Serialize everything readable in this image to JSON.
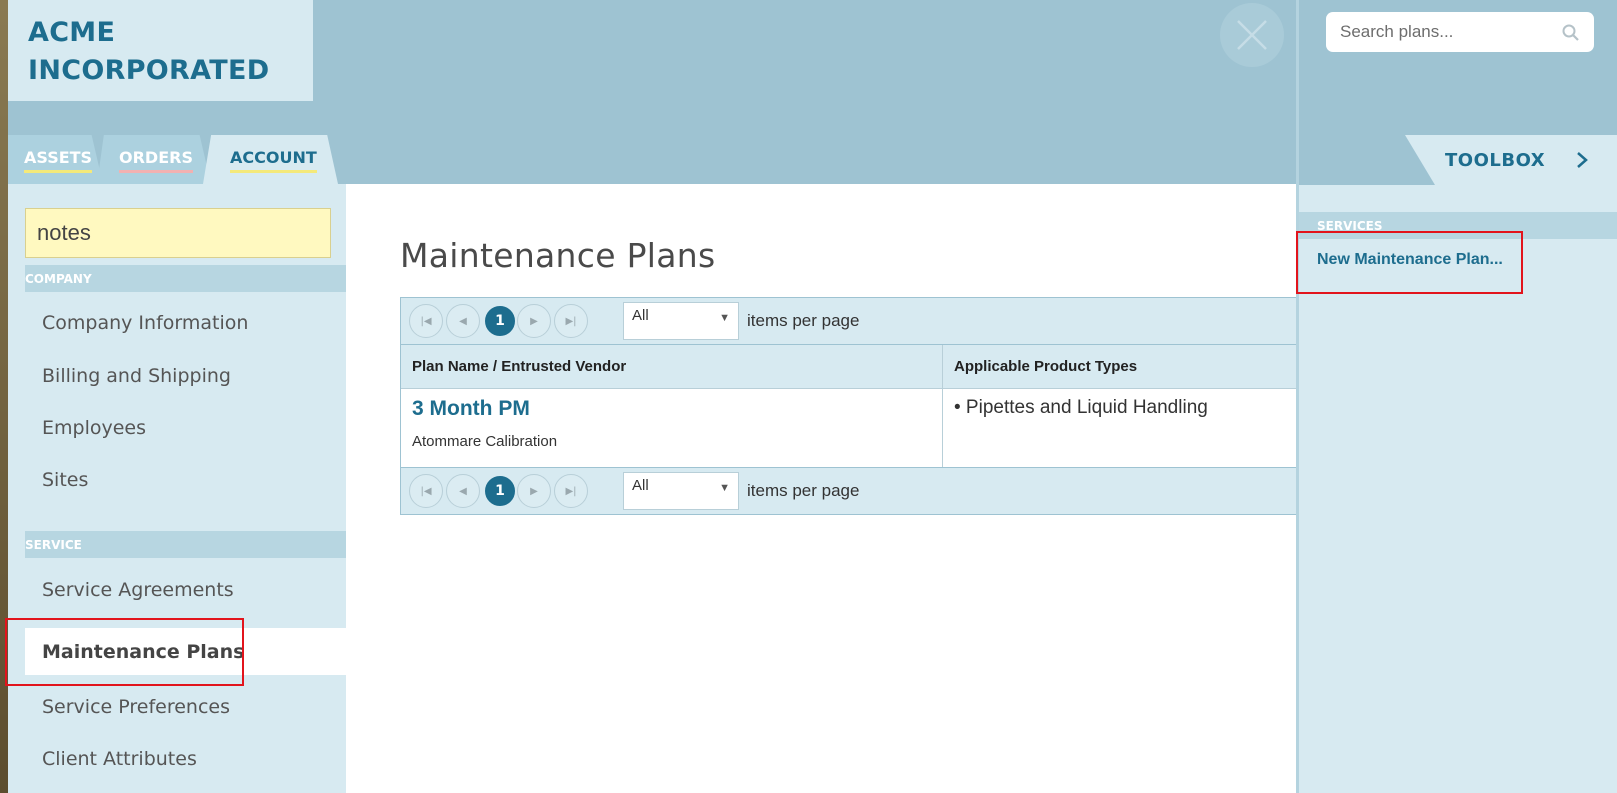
{
  "company": {
    "line1": "ACME",
    "line2": "INCORPORATED"
  },
  "search": {
    "placeholder": "Search plans..."
  },
  "tabs": [
    {
      "label": "ASSETS",
      "underline": "#f4e97a"
    },
    {
      "label": "ORDERS",
      "underline": "#f2b1b1"
    },
    {
      "label": "ACCOUNT",
      "underline": "#f4e97a"
    }
  ],
  "sidebar": {
    "filter_value": "notes",
    "sections": [
      {
        "title": "COMPANY",
        "items": [
          "Company Information",
          "Billing and Shipping",
          "Employees",
          "Sites"
        ]
      },
      {
        "title": "SERVICE",
        "items": [
          "Service Agreements",
          "Maintenance Plans",
          "Service Preferences",
          "Client Attributes"
        ]
      }
    ],
    "active_item": "Maintenance Plans"
  },
  "main": {
    "title": "Maintenance Plans",
    "pager": {
      "current_page": "1",
      "page_size": "All",
      "items_per_page_label": "items per page"
    },
    "columns": [
      "Plan Name / Entrusted Vendor",
      "Applicable Product Types"
    ],
    "rows": [
      {
        "plan_name": "3 Month PM",
        "vendor": "Atommare Calibration",
        "product_types": "• Pipettes and Liquid Handling"
      }
    ]
  },
  "toolbox": {
    "title": "TOOLBOX",
    "section": "SERVICES",
    "link": "New Maintenance Plan..."
  },
  "colors": {
    "brand": "#1d6d8e",
    "header_bg": "#9ec3d2",
    "panel_bg": "#d7eaf1",
    "highlight": "#e2141c"
  },
  "icons": {
    "close": "close-icon",
    "search": "search-icon",
    "toolbox": "chevron-right-icon"
  }
}
